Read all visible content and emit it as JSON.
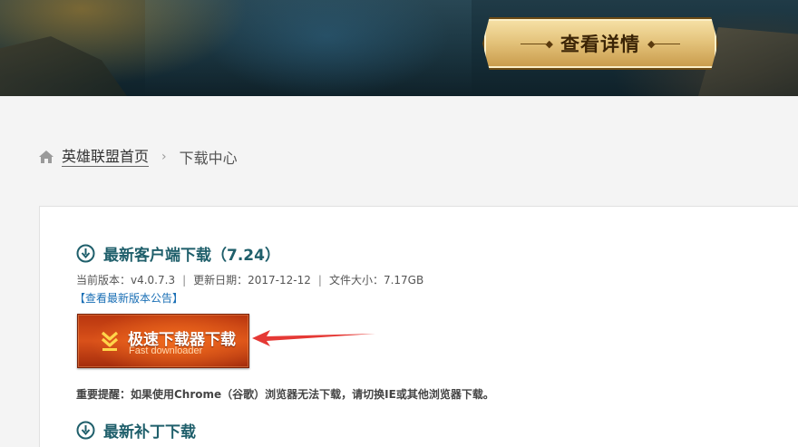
{
  "banner": {
    "detail_button_label": "查看详情"
  },
  "breadcrumb": {
    "home_label": "英雄联盟首页",
    "separator": "›",
    "current_label": "下载中心"
  },
  "client_section": {
    "title": "最新客户端下载（7.24）",
    "version_text": "当前版本：v4.0.7.3",
    "update_date_text": "更新日期：2017-12-12",
    "file_size_text": "文件大小：7.17GB",
    "meta_separator": "|",
    "notice_link": "【查看最新版本公告】",
    "fast_download": {
      "title": "极速下载器下载",
      "subtitle": "Fast downloader"
    },
    "warning": "重要提醒：如果使用Chrome（谷歌）浏览器无法下载，请切换IE或其他浏览器下载。"
  },
  "patch_section": {
    "title": "最新补丁下载"
  },
  "colors": {
    "section_title": "#1f5f6b",
    "link": "#1a6fb5",
    "download_button": "#d9511a",
    "arrow": "#e53935"
  },
  "icons": {
    "home": "home-icon",
    "section": "download-circle-icon",
    "fast_download": "chevron-down-icon",
    "annotation": "arrow-left-icon"
  }
}
